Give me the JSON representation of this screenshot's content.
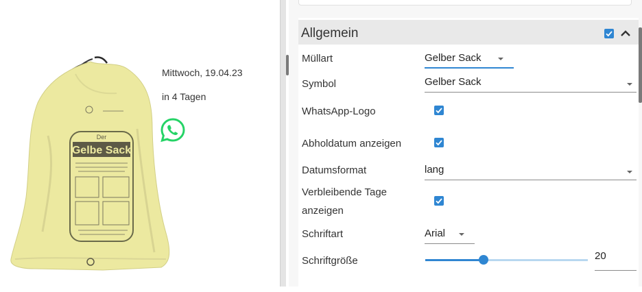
{
  "preview": {
    "date": "Mittwoch, 19.04.23",
    "days_left": "in 4 Tagen",
    "bag_logo_small": "Der",
    "bag_logo_big": "Gelbe Sack",
    "whatsapp_icon": "whatsapp-icon"
  },
  "panel": {
    "section_title": "Allgemein",
    "section_enabled": true,
    "rows": {
      "muellart": {
        "label": "Müllart",
        "value": "Gelber Sack"
      },
      "symbol": {
        "label": "Symbol",
        "value": "Gelber Sack"
      },
      "whatsapp": {
        "label": "WhatsApp-Logo",
        "checked": true
      },
      "abholdatum": {
        "label": "Abholdatum anzeigen",
        "checked": true
      },
      "datumsformat": {
        "label": "Datumsformat",
        "value": "lang"
      },
      "verbleibend": {
        "label_line1": "Verbleibende Tage",
        "label_line2": "anzeigen",
        "checked": true
      },
      "schriftart": {
        "label": "Schriftart",
        "value": "Arial"
      },
      "schriftgroesse": {
        "label": "Schriftgröße",
        "value": "20",
        "slider_fraction": 0.36
      }
    }
  },
  "colors": {
    "accent": "#2f86d2",
    "bag_yellow": "#ece9a0",
    "whatsapp_green": "#25d366"
  }
}
